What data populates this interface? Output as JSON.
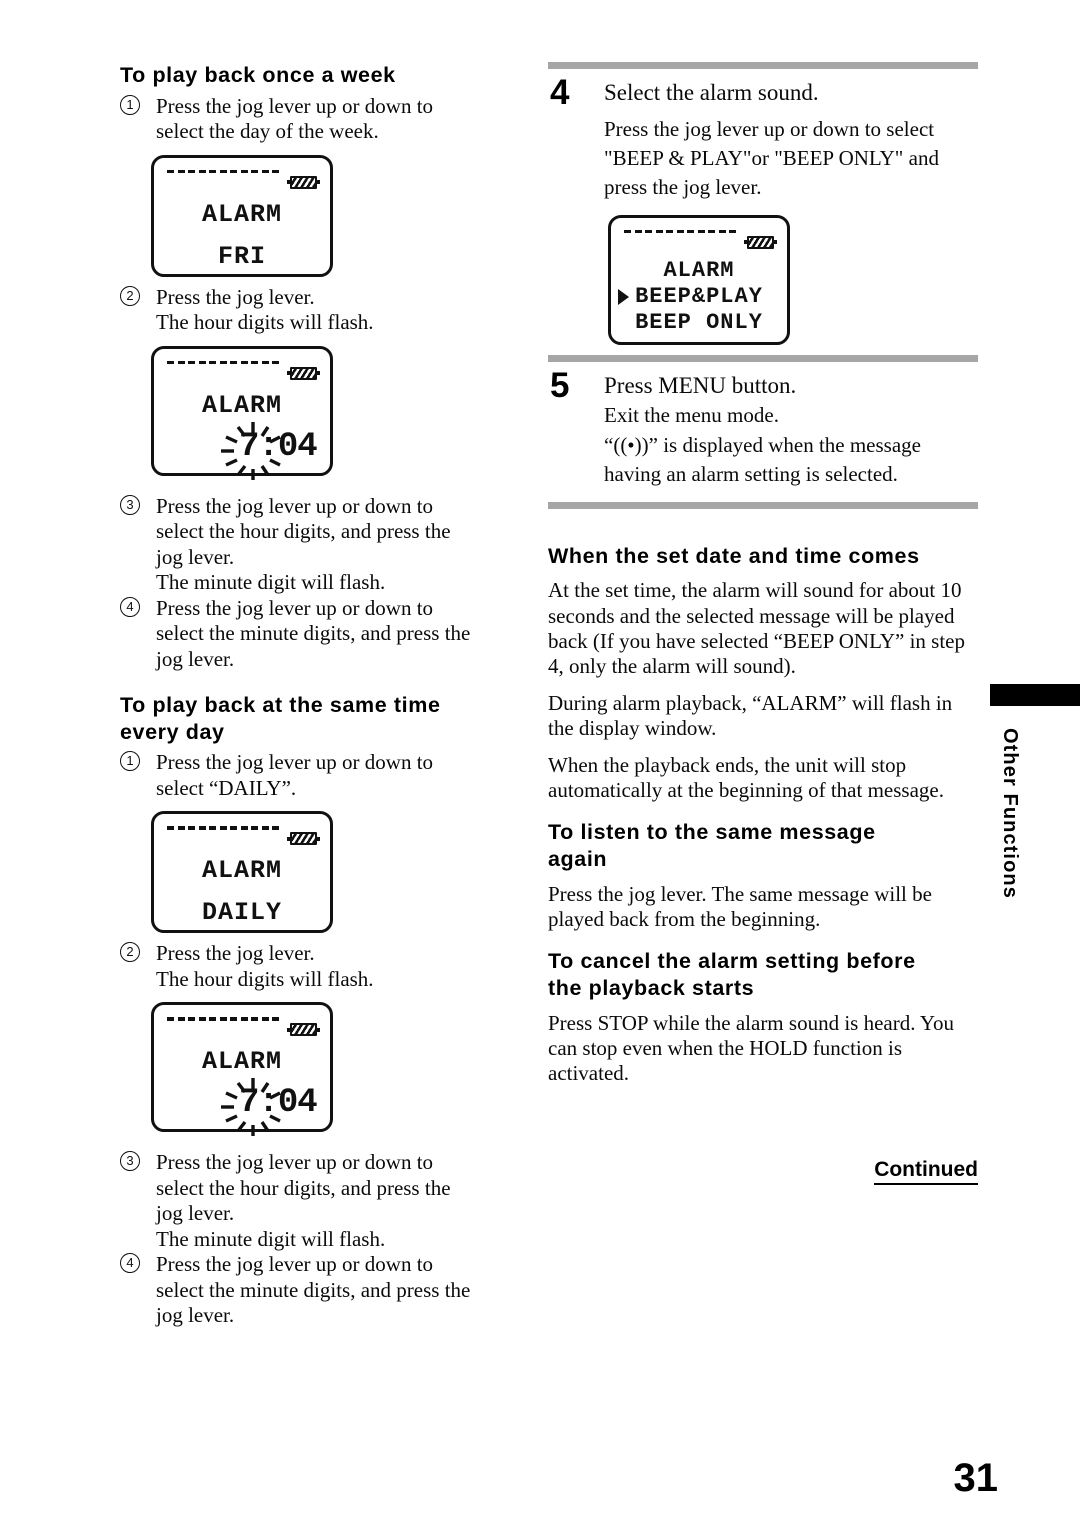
{
  "page": {
    "number": "31",
    "continued_label": "Continued",
    "side_tab": "Other Functions"
  },
  "left_column": {
    "section1": {
      "heading": "To play back once a week",
      "steps": [
        {
          "marker": "1",
          "lines": [
            "Press the jog lever up or down to",
            "select the day of the week."
          ]
        },
        {
          "marker": "2",
          "lines": [
            "Press the jog lever."
          ],
          "note": "The hour digits will flash."
        },
        {
          "marker": "3",
          "lines": [
            "Press the jog lever up or down to",
            "select the hour digits, and press the",
            "jog lever."
          ],
          "note": "The minute digit will flash."
        },
        {
          "marker": "4",
          "lines": [
            "Press the jog lever up or down to",
            "select the minute digits, and press the",
            "jog lever."
          ]
        }
      ],
      "lcd_day": {
        "line1": "ALARM",
        "line2": "FRI"
      },
      "lcd_time": {
        "line1": "ALARM",
        "hour": "7",
        "sep": ":",
        "minute": "04"
      }
    },
    "section2": {
      "heading_line1": "To play back at the same time",
      "heading_line2": "every day",
      "steps": [
        {
          "marker": "1",
          "lines": [
            "Press the jog lever up or down to",
            "select “DAILY”."
          ]
        },
        {
          "marker": "2",
          "lines": [
            "Press the jog lever."
          ],
          "note": "The hour digits will flash."
        },
        {
          "marker": "3",
          "lines": [
            "Press the jog lever up or down to",
            "select the hour digits, and press the",
            "jog lever."
          ],
          "note": "The minute digit will flash."
        },
        {
          "marker": "4",
          "lines": [
            "Press the jog lever up or down to",
            "select the minute digits, and press the",
            "jog lever."
          ]
        }
      ],
      "lcd_day": {
        "line1": "ALARM",
        "line2": "DAILY"
      },
      "lcd_time": {
        "line1": "ALARM",
        "hour": "7",
        "sep": ":",
        "minute": "04"
      }
    }
  },
  "right_column": {
    "step4": {
      "number": "4",
      "lead": "Select the alarm sound.",
      "body_line1": "Press the jog lever up or down to select",
      "body_line2": "\"BEEP & PLAY\"or \"BEEP ONLY\" and",
      "body_line3": "press the jog lever.",
      "lcd": {
        "line1": "ALARM",
        "line2": "BEEP&PLAY",
        "line3": "BEEP ONLY",
        "selected": "BEEP&PLAY"
      }
    },
    "step5": {
      "number": "5",
      "lead": "Press MENU button.",
      "body_line1": "Exit the menu mode.",
      "body_line2": "“((•))” is displayed when the message",
      "body_line3": "having an alarm setting is selected."
    },
    "section_when": {
      "heading": "When the set date and time comes",
      "paragraphs": [
        "At the set time, the alarm will sound for about 10 seconds and the selected message will be played back (If you have selected “BEEP ONLY” in step 4, only the alarm will sound).",
        "During alarm playback, “ALARM” will flash in the display window.",
        "When the playback ends, the unit will stop automatically at the beginning of that message."
      ]
    },
    "section_listen": {
      "heading_line1": "To listen to the same message",
      "heading_line2": "again",
      "paragraph": "Press the jog lever. The same message will be played back from the beginning."
    },
    "section_cancel": {
      "heading_line1": "To cancel the alarm setting before",
      "heading_line2": "the playback starts",
      "paragraph": "Press STOP while the alarm sound is heard. You can stop even when the HOLD function is activated."
    }
  },
  "colors": {
    "rule": "#a6a6a6",
    "ink": "#0a0a0a"
  }
}
